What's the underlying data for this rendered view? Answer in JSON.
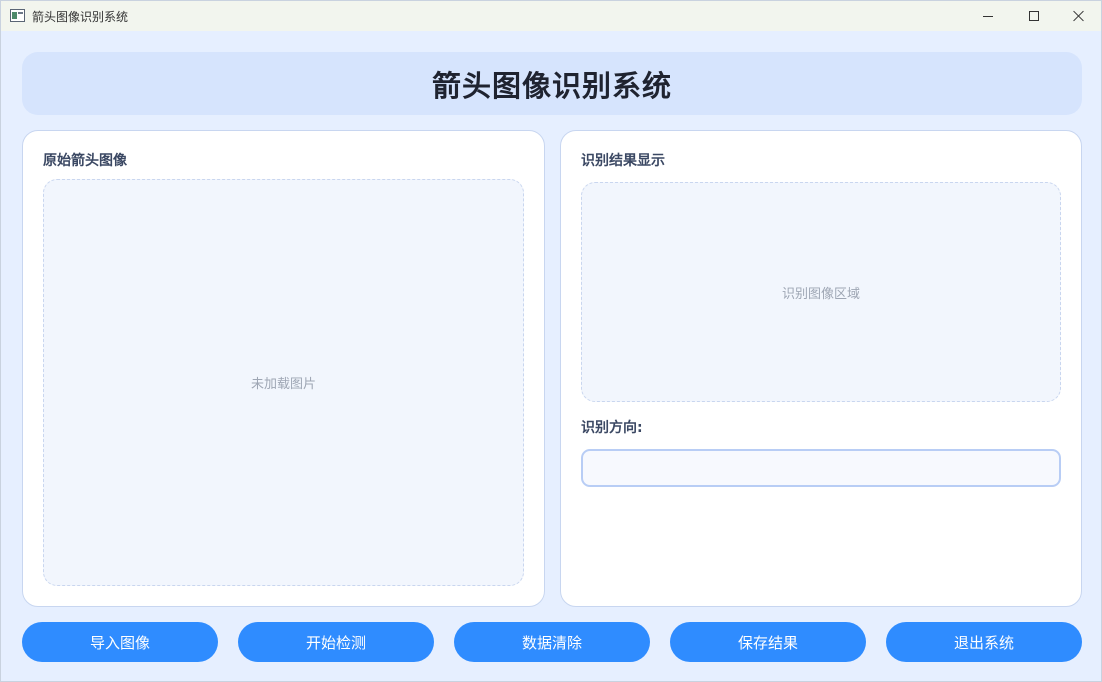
{
  "window": {
    "title": "箭头图像识别系统",
    "icon": "app-window-icon",
    "controls": [
      "minimize-icon",
      "maximize-icon",
      "close-icon"
    ]
  },
  "header": {
    "title": "箭头图像识别系统"
  },
  "left_panel": {
    "title": "原始箭头图像",
    "placeholder": "未加载图片"
  },
  "right_panel": {
    "title": "识别结果显示",
    "placeholder": "识别图像区域",
    "direction_label": "识别方向:",
    "direction_value": "",
    "direction_placeholder": ""
  },
  "buttons": {
    "import": "导入图像",
    "detect": "开始检测",
    "clear": "数据清除",
    "save": "保存结果",
    "exit": "退出系统"
  },
  "colors": {
    "background": "#e6efff",
    "header_bg": "#d6e4fd",
    "accent": "#2f8cff",
    "panel_bg": "#ffffff",
    "image_area_bg": "#f2f6fd"
  }
}
